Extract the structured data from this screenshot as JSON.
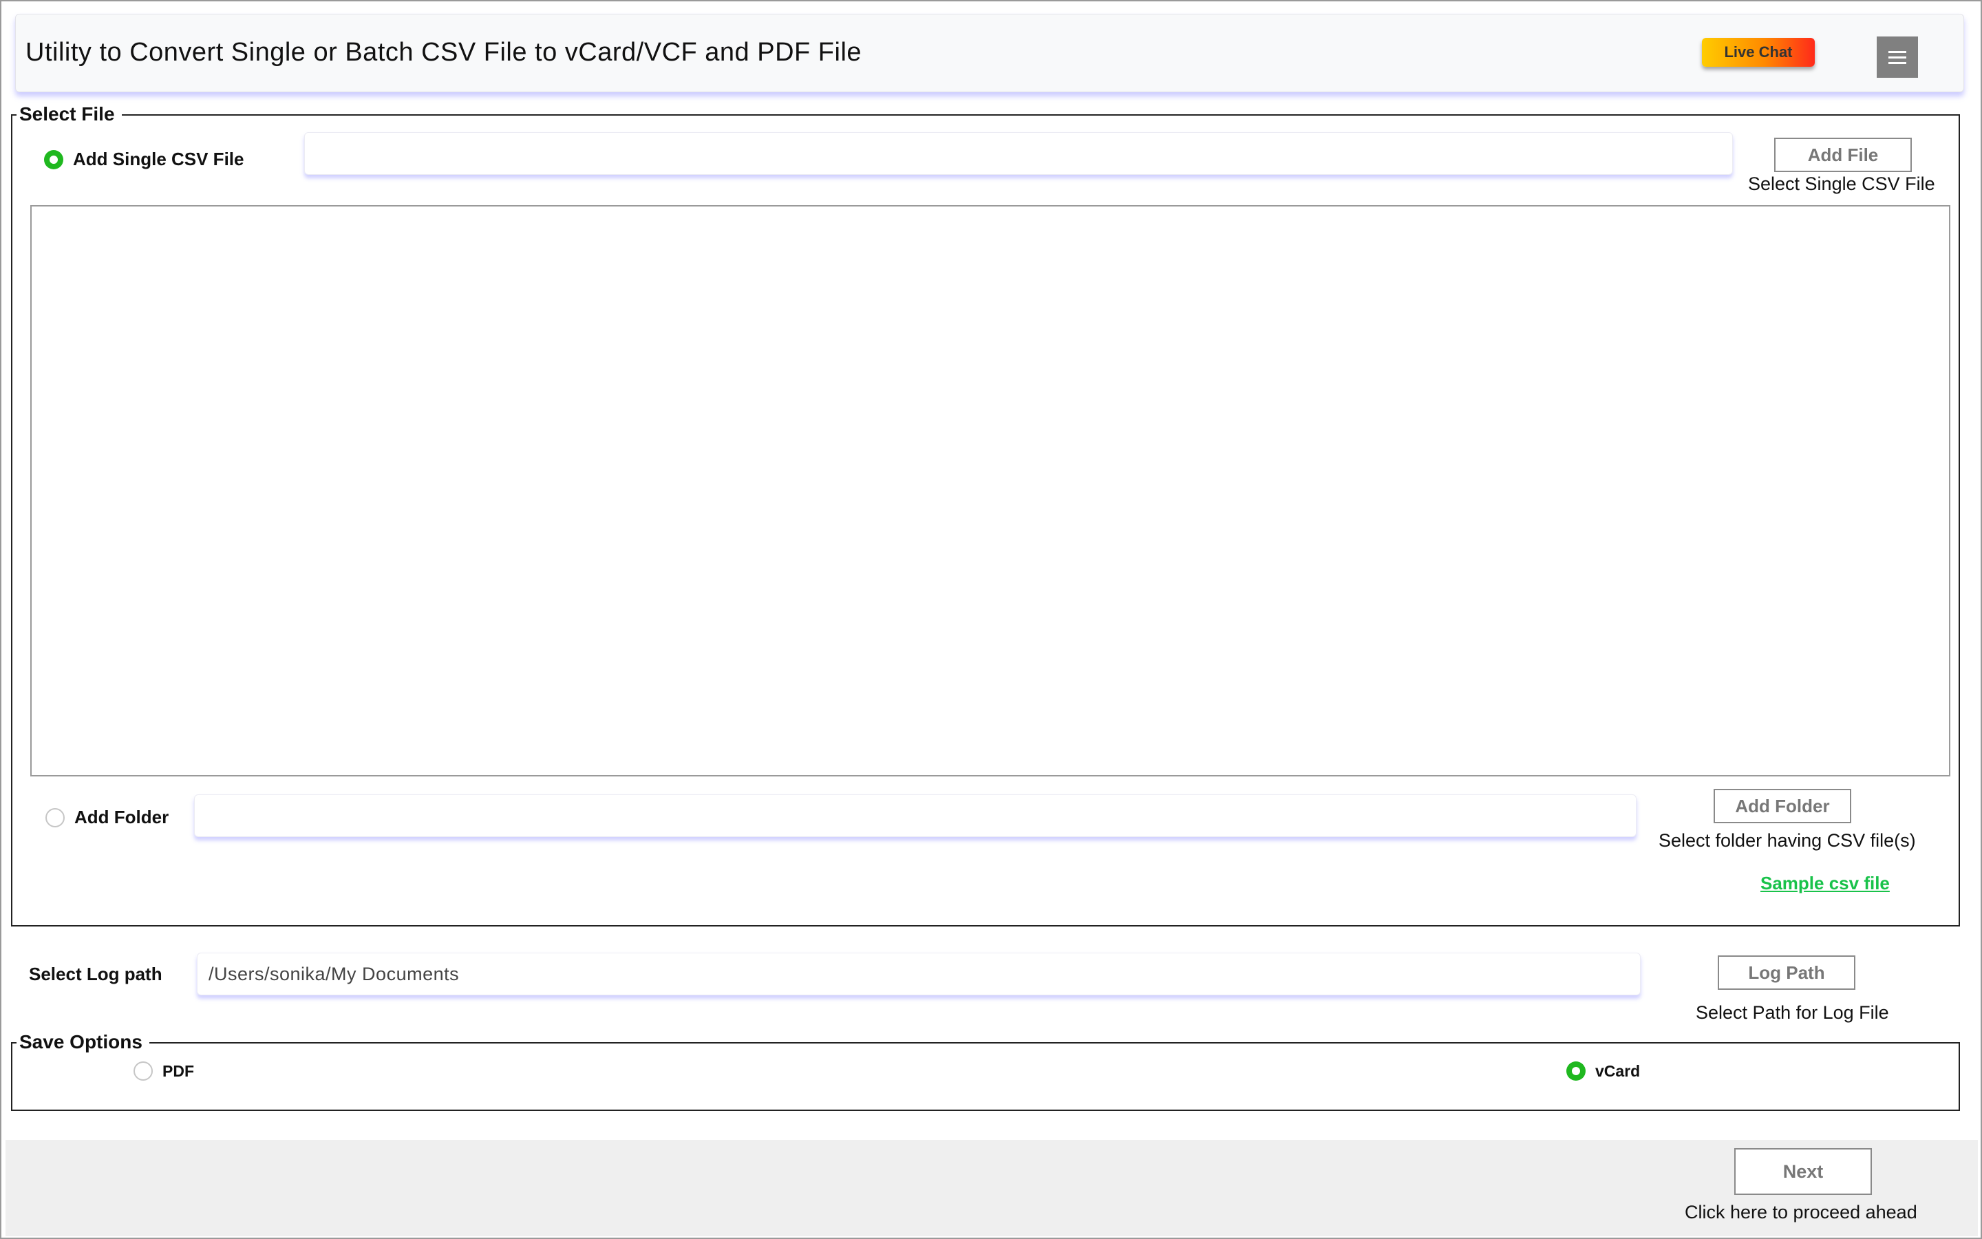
{
  "header": {
    "title": "Utility to Convert Single or Batch CSV File to vCard/VCF and PDF File",
    "live_chat_label": "Live Chat",
    "menu_icon": "hamburger-menu-icon"
  },
  "select_file": {
    "legend": "Select File",
    "single": {
      "label": "Add Single CSV File",
      "checked": true,
      "path_value": "",
      "button_label": "Add File",
      "caption": "Select Single CSV File"
    },
    "folder": {
      "label": "Add Folder",
      "checked": false,
      "path_value": "",
      "button_label": "Add Folder",
      "caption": "Select folder having CSV file(s)"
    },
    "sample_link": "Sample csv file"
  },
  "log": {
    "label": "Select Log path",
    "path_value": "/Users/sonika/My Documents",
    "button_label": "Log Path",
    "caption": "Select Path for Log File"
  },
  "save_options": {
    "legend": "Save Options",
    "pdf_label": "PDF",
    "pdf_checked": false,
    "vcard_label": "vCard",
    "vcard_checked": true
  },
  "footer": {
    "next_label": "Next",
    "caption": "Click here to proceed ahead"
  },
  "colors": {
    "accent_green": "#1fb81f",
    "link_green": "#19c24a",
    "live_chat_gradient": [
      "#ffcc00",
      "#ff8a00",
      "#ff2a1a"
    ],
    "menu_button": "#808080"
  }
}
